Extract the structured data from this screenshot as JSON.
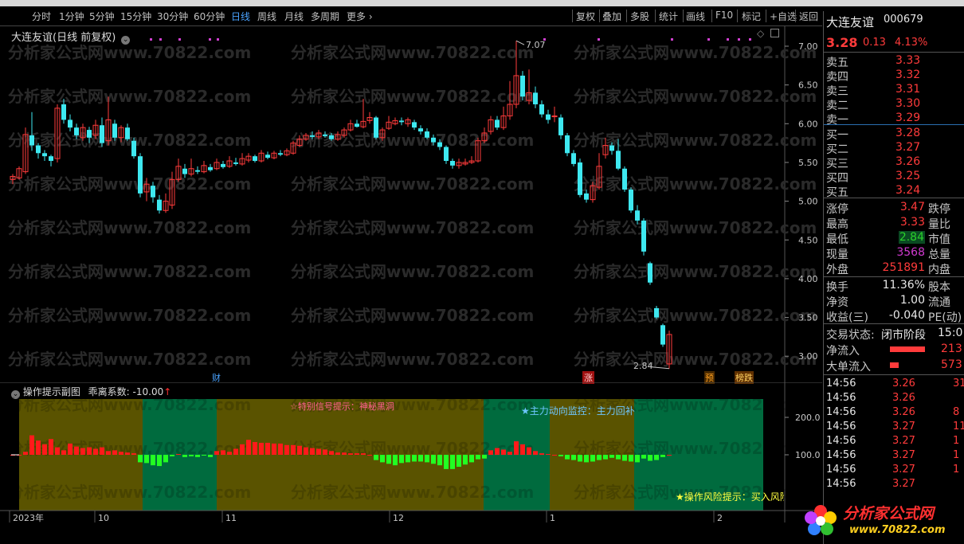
{
  "toolbar": {
    "periods": [
      "分时",
      "1分钟",
      "5分钟",
      "15分钟",
      "30分钟",
      "60分钟",
      "日线",
      "周线",
      "月线",
      "多周期",
      "更多 ›"
    ],
    "active_period": "日线",
    "tools": [
      "复权",
      "叠加",
      "多股",
      "统计",
      "画线",
      "F10",
      "标记",
      "+自选",
      "返回"
    ]
  },
  "main_chart": {
    "title": "大连友谊(日线 前复权)",
    "high_label": "7.07",
    "low_label": "2.84",
    "y_ticks": [
      "7.00",
      "6.50",
      "6.00",
      "5.50",
      "5.00",
      "4.50",
      "4.00",
      "3.50",
      "3.00"
    ],
    "markers": {
      "cai": "财",
      "zhang": "涨",
      "yu": "预",
      "die": "榜跌"
    },
    "colors": {
      "up": "#ff3b3b",
      "down": "#3ee8f0",
      "bg": "#000000"
    }
  },
  "sub_chart": {
    "title": "操作提示副图",
    "coef_label": "乖离系数: -10.00",
    "coef_arrow": "↑",
    "signal_text": "☆特别信号提示：神秘黑洞",
    "main_force_text": "★主力动向监控：主力回补",
    "risk_text": "★操作风险提示：买入风险",
    "y_ticks": [
      "200.0",
      "100.0"
    ],
    "colors": {
      "olive": "#5a5300",
      "teal": "#006b3e",
      "red": "#ff1a1a",
      "green": "#22ff22"
    }
  },
  "x_axis": {
    "labels": [
      "2023年",
      "10",
      "11",
      "12",
      "1",
      "2"
    ]
  },
  "watermarks": [
    "分析家公式网www.70822.com"
  ],
  "right_panel": {
    "name": "大连友谊",
    "code": "000679",
    "price": "3.28",
    "change": "0.13",
    "change_pct": "4.13%",
    "asks": [
      {
        "label": "卖五",
        "price": "3.33"
      },
      {
        "label": "卖四",
        "price": "3.32"
      },
      {
        "label": "卖三",
        "price": "3.31"
      },
      {
        "label": "卖二",
        "price": "3.30"
      },
      {
        "label": "卖一",
        "price": "3.29"
      }
    ],
    "bids": [
      {
        "label": "买一",
        "price": "3.28"
      },
      {
        "label": "买二",
        "price": "3.27"
      },
      {
        "label": "买三",
        "price": "3.26"
      },
      {
        "label": "买四",
        "price": "3.25"
      },
      {
        "label": "买五",
        "price": "3.24"
      }
    ],
    "stats": [
      {
        "l": "涨停",
        "v": "3.47",
        "r": "跌停",
        "cls": "red"
      },
      {
        "l": "最高",
        "v": "3.33",
        "r": "量比",
        "cls": "red"
      },
      {
        "l": "最低",
        "v": "2.84",
        "r": "市值",
        "cls": "green"
      },
      {
        "l": "现量",
        "v": "3568",
        "r": "总量",
        "cls": "mag"
      },
      {
        "l": "外盘",
        "v": "251891",
        "r": "内盘",
        "cls": "red"
      }
    ],
    "stats2": [
      {
        "l": "换手",
        "v": "11.36%",
        "r": "股本"
      },
      {
        "l": "净资",
        "v": "1.00",
        "r": "流通"
      },
      {
        "l": "收益(三)",
        "v": "-0.040",
        "r": "PE(动)"
      }
    ],
    "trade_state_label": "交易状态:",
    "trade_state": "闭市阶段",
    "trade_time": "15:0",
    "net_inflow_label": "净流入",
    "net_inflow": "213",
    "big_inflow_label": "大单流入",
    "big_inflow": "573",
    "ticks": [
      {
        "t": "14:56",
        "p": "3.26",
        "v": "31"
      },
      {
        "t": "14:56",
        "p": "3.26",
        "v": ""
      },
      {
        "t": "14:56",
        "p": "3.26",
        "v": "8"
      },
      {
        "t": "14:56",
        "p": "3.27",
        "v": "11"
      },
      {
        "t": "14:56",
        "p": "3.27",
        "v": "1"
      },
      {
        "t": "14:56",
        "p": "3.27",
        "v": "1"
      },
      {
        "t": "14:56",
        "p": "3.27",
        "v": "1"
      },
      {
        "t": "14:56",
        "p": "3.27",
        "v": ""
      }
    ]
  },
  "logo": {
    "text": "分析家公式网",
    "url": "www.70822.com"
  }
}
